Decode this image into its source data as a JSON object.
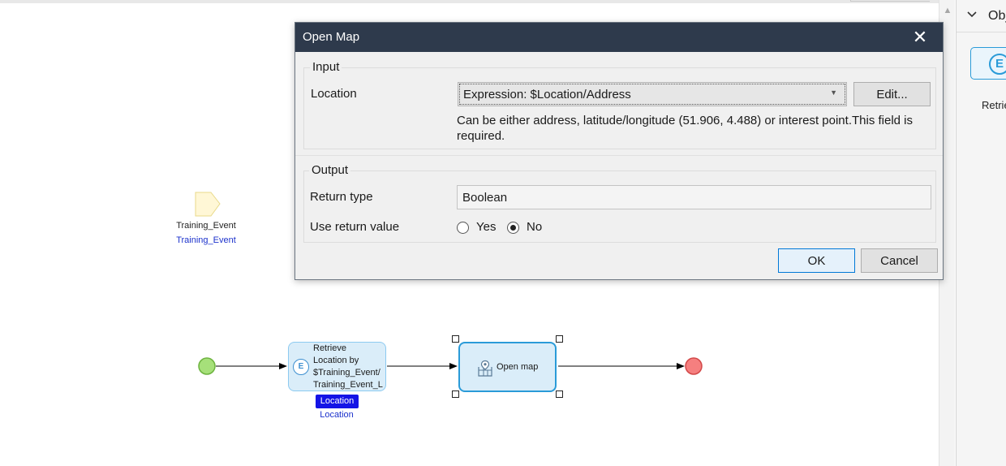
{
  "canvas": {
    "parameter": {
      "name": "Training_Event",
      "type": "Training_Event"
    },
    "flow": {
      "retrieve_activity": {
        "lines": [
          "Retrieve",
          "Location by",
          "$Training_Event/",
          "Training_Event_L"
        ],
        "output_name": "Location",
        "output_type": "Location"
      },
      "open_map_activity": {
        "label": "Open map"
      }
    }
  },
  "right_panel": {
    "header_title": "Obj",
    "tile_icon_letter": "E",
    "label": "Retrie"
  },
  "dialog": {
    "title": "Open Map",
    "close_glyph": "✕",
    "input_group": {
      "title": "Input",
      "location_label": "Location",
      "location_value": "Expression: $Location/Address",
      "edit_button": "Edit...",
      "hint": "Can be either address, latitude/longitude (51.906, 4.488) or interest point.This field is required."
    },
    "output_group": {
      "title": "Output",
      "return_type_label": "Return type",
      "return_type_value": "Boolean",
      "use_return_label": "Use return value",
      "option_yes": "Yes",
      "option_no": "No",
      "selected": "No"
    },
    "ok_button": "OK",
    "cancel_button": "Cancel"
  },
  "colors": {
    "titlebar": "#2e3a4c",
    "activity_fill": "#daedf9",
    "activity_border": "#2a9bd8",
    "start_event": "#a6e07a",
    "end_event": "#f57f7f",
    "output_badge": "#1414e6"
  },
  "icons": {
    "retrieve": "database-retrieve-icon",
    "open_map": "map-pin-icon",
    "close": "close-icon",
    "dropdown": "chevron-down-icon"
  }
}
